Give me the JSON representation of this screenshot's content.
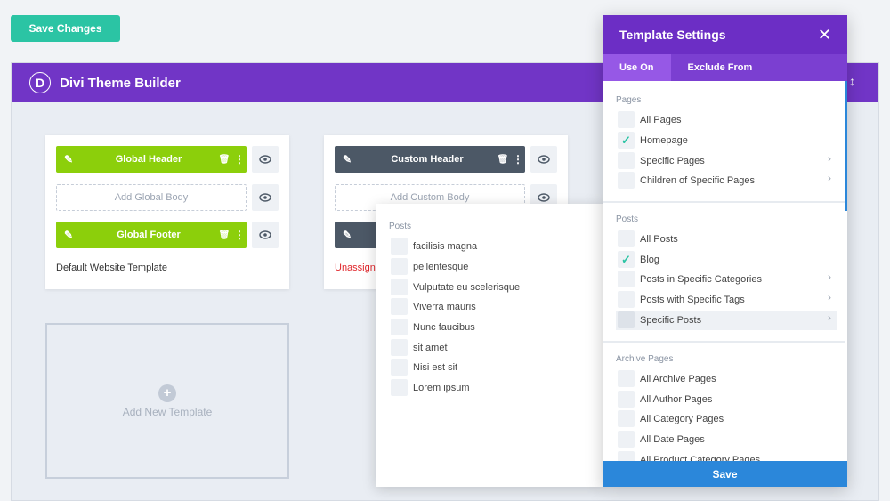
{
  "toolbar": {
    "save_changes": "Save Changes"
  },
  "builder": {
    "logo": "D",
    "title": "Divi Theme Builder",
    "right_icon": "↕"
  },
  "cards": {
    "default": {
      "header": "Global Header",
      "body": "Add Global Body",
      "footer": "Global Footer",
      "name": "Default Website Template"
    },
    "custom": {
      "header": "Custom Header",
      "body": "Add Custom Body",
      "name": "Unassigne"
    }
  },
  "add_new": {
    "plus": "+",
    "label": "Add New Template"
  },
  "posts_flyout": {
    "heading": "Posts",
    "items": [
      "facilisis magna",
      "pellentesque",
      "Vulputate eu scelerisque",
      "Viverra mauris",
      "Nunc faucibus",
      "sit amet",
      "Nisi est sit",
      "Lorem ipsum"
    ]
  },
  "modal": {
    "title": "Template Settings",
    "close": "✕",
    "tabs": [
      "Use On",
      "Exclude From"
    ],
    "pages_heading": "Pages",
    "pages": [
      "All Pages",
      "Homepage",
      "Specific Pages",
      "Children of Specific Pages"
    ],
    "posts_heading": "Posts",
    "posts": [
      "All Posts",
      "Blog",
      "Posts in Specific Categories",
      "Posts with Specific Tags",
      "Specific Posts"
    ],
    "archive_heading": "Archive Pages",
    "archive": [
      "All Archive Pages",
      "All Author Pages",
      "All Category Pages",
      "All Date Pages",
      "All Product Category Pages"
    ],
    "save": "Save",
    "checkmark": "✓",
    "chevron": "›"
  },
  "colors": {
    "accent_purple": "#7135c6",
    "green": "#8ccf0b",
    "teal": "#2bc4a4",
    "blue": "#2b87da"
  }
}
